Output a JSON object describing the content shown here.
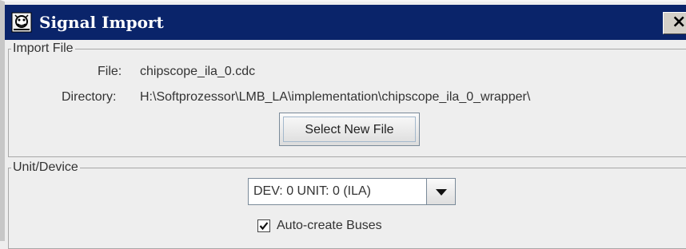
{
  "window": {
    "title": "Signal Import",
    "close_glyph": "×",
    "icon": "chipscope-app-icon"
  },
  "import_file": {
    "group_title": "Import File",
    "file_label": "File:",
    "file_value": "chipscope_ila_0.cdc",
    "directory_label": "Directory:",
    "directory_value": "H:\\Softprozessor\\LMB_LA\\implementation\\chipscope_ila_0_wrapper\\",
    "select_button": "Select New File"
  },
  "unit_device": {
    "group_title": "Unit/Device",
    "selected": "DEV: 0 UNIT: 0 (ILA)",
    "auto_create_label": "Auto-create Buses",
    "auto_create_checked": true
  }
}
